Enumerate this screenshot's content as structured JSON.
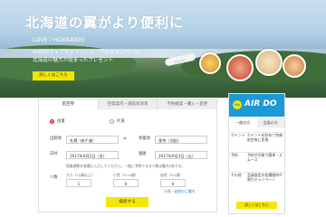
{
  "hero": {
    "title": "北海道の翼がより便利に",
    "line1": "LOVE♡HOKKAIDO",
    "line2": "AIRDOウェブサイトリニューアルキャンペーン",
    "line3": "北海道の魅力が詰まったプレゼント",
    "button": "詳しくはこちら"
  },
  "tabs": [
    "航空券",
    "空席案内・運航状況等",
    "予約確認・購入・変更"
  ],
  "form": {
    "trip_oneway": "往復",
    "trip_return": "片道",
    "from_label": "出発地",
    "from_value": "札幌（新千歳）",
    "to_label": "到着地",
    "to_value": "東京（羽田）",
    "date_label": "日付",
    "date_value": "2017年6月2日（金）",
    "return_label": "復路",
    "return_value": "2017年6月3日（土）",
    "note": "搭乗者数を各欄に入力してください。一度に予約できる人数は最大9名です。",
    "pax_label": "人数",
    "adult": "大人（12歳以上）",
    "adult_value": "1",
    "child": "小児（3-11歳）",
    "child_value": "0",
    "infant": "幼児（0-2歳）",
    "infant_value": "0",
    "link": "小児・幼児のご案内",
    "search": "検索する"
  },
  "side": {
    "logo_badge": "My",
    "logo": "AIR DO",
    "tabs": [
      "一般の方",
      "会員の方"
    ],
    "rows": [
      {
        "k": "ポイント",
        "v": "ポイントを貯めて特典航空券に変換"
      },
      {
        "k": "予約",
        "v": "予約が可能で簡単・スムーズ"
      },
      {
        "k": "その他",
        "v": "会員限定の各種優待や割引キャンペーン"
      }
    ],
    "button": "詳しくはこちら"
  }
}
